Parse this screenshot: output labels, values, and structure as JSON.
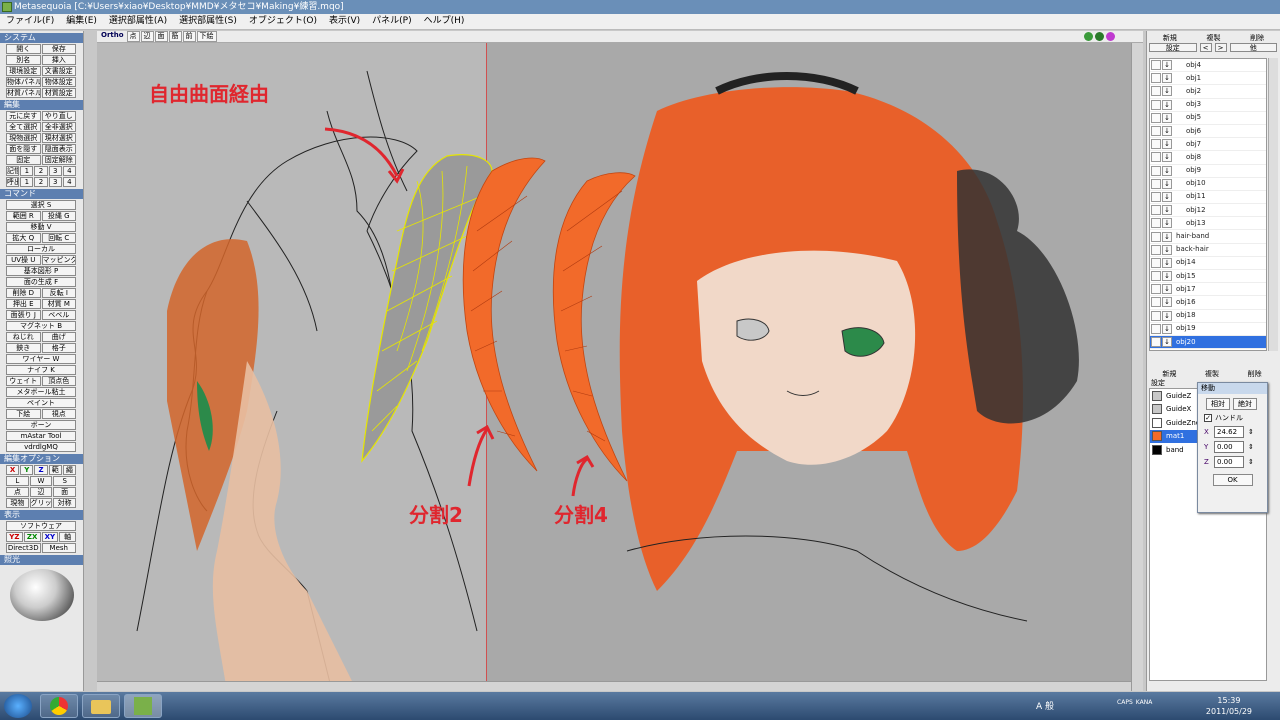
{
  "window": {
    "title": "Metasequoia [C:¥Users¥xiao¥Desktop¥MMD¥メタセコ¥Making¥練習.mqo]"
  },
  "menu": [
    "ファイル(F)",
    "編集(E)",
    "選択部属性(A)",
    "選択部属性(S)",
    "オブジェクト(O)",
    "表示(V)",
    "パネル(P)",
    "ヘルプ(H)"
  ],
  "left_panel": {
    "system": {
      "header": "システム",
      "rows": [
        [
          "開く",
          "保存"
        ],
        [
          "別名",
          "挿入"
        ],
        [
          "環境設定",
          "文書設定"
        ],
        [
          "物体パネル",
          "物体設定"
        ],
        [
          "材質パネル",
          "材質設定"
        ]
      ]
    },
    "edit": {
      "header": "編集",
      "rows": [
        [
          "元に戻す",
          "やり直し"
        ],
        [
          "全て選択",
          "全非選択"
        ],
        [
          "現物選択",
          "現材選択"
        ],
        [
          "面を隠す",
          "隠面表示"
        ],
        [
          "固定",
          "固定解除"
        ],
        [
          "記憶",
          "1",
          "2",
          "3",
          "4"
        ],
        [
          "呼出",
          "1",
          "2",
          "3",
          "4"
        ]
      ]
    },
    "command": {
      "header": "コマンド",
      "rows": [
        [
          "選択 S"
        ],
        [
          "範囲 R",
          "投縄 G"
        ],
        [
          "移動 V"
        ],
        [
          "拡大 Q",
          "回転 C"
        ],
        [
          "ローカル"
        ],
        [
          "UV操 U",
          "マッピング"
        ],
        [
          "基本図形 P"
        ],
        [
          "面の生成 F"
        ],
        [
          "削除 D",
          "反転 I"
        ],
        [
          "押出 E",
          "材質 M"
        ],
        [
          "面張り J",
          "ベベル"
        ],
        [
          "マグネット B"
        ],
        [
          "ねじれ",
          "曲げ"
        ],
        [
          "鋏き",
          "格子"
        ],
        [
          "ワイヤー W"
        ],
        [
          "ナイフ K"
        ],
        [
          "ウェイト",
          "頂点色"
        ],
        [
          "メタボール粘土"
        ],
        [
          "ペイント"
        ],
        [
          "下絵",
          "視点"
        ],
        [
          "ボーン"
        ],
        [
          "mAstar Tool"
        ],
        [
          "vdrdlgMQ"
        ]
      ]
    },
    "edit_option": {
      "header": "編集オプション",
      "rows": [
        [
          "X",
          "Y",
          "Z",
          "範",
          "繩"
        ],
        [
          "L",
          "W",
          "S"
        ],
        [
          "点",
          "辺",
          "面"
        ],
        [
          "現物",
          "グリッド",
          "対称"
        ]
      ]
    },
    "display": {
      "header": "表示",
      "rows": [
        [
          "ソフトウェア"
        ],
        [
          "YZ",
          "ZX",
          "XY",
          "軸"
        ],
        [
          "Direct3D",
          "Mesh"
        ]
      ]
    },
    "light": {
      "header": "照光"
    }
  },
  "viewport": {
    "toolbar": [
      "Ortho",
      "点",
      "辺",
      "面",
      "筋",
      "前",
      "下絵"
    ],
    "annotations": {
      "a1": "自由曲面経由",
      "a2": "分割2",
      "a3": "分割4"
    }
  },
  "object_panel": {
    "buttons_top": [
      "新規",
      "複製",
      "削除"
    ],
    "buttons_second": [
      "設定",
      "<",
      ">",
      "他"
    ],
    "objects": [
      "obj4",
      "obj1",
      "obj2",
      "obj3",
      "obj5",
      "obj6",
      "obj7",
      "obj8",
      "obj9",
      "obj10",
      "obj11",
      "obj12",
      "obj13",
      "hair-band",
      "back-hair",
      "obj14",
      "obj15",
      "obj17",
      "obj16",
      "obj18",
      "obj19",
      "obj20"
    ],
    "selected": "obj20"
  },
  "material_panel": {
    "buttons_top": [
      "新規",
      "複製",
      "削除"
    ],
    "button_second": "設定",
    "materials": [
      {
        "name": "GuideZ",
        "color": "#c8c8c8"
      },
      {
        "name": "GuideX",
        "color": "#c8c8c8"
      },
      {
        "name": "GuideZnew",
        "color": "#ffffff"
      },
      {
        "name": "mat1",
        "color": "#f26a2a"
      },
      {
        "name": "band",
        "color": "#000000"
      }
    ],
    "selected": "mat1"
  },
  "move_dialog": {
    "title": "移動",
    "relative": "相対",
    "absolute": "絶対",
    "handle_label": "ハンドル",
    "handle_checked": true,
    "x_label": "X",
    "x_value": "24.62",
    "y_label": "Y",
    "y_value": "0.00",
    "z_label": "Z",
    "z_value": "0.00",
    "ok": "OK"
  },
  "taskbar": {
    "ime": "A 般",
    "caps": "CAPS",
    "kana": "KANA",
    "time": "15:39",
    "date": "2011/05/29"
  },
  "colors": {
    "accent": "#3070e0",
    "annotation": "#e0262e",
    "hair": "#f26a2a"
  }
}
